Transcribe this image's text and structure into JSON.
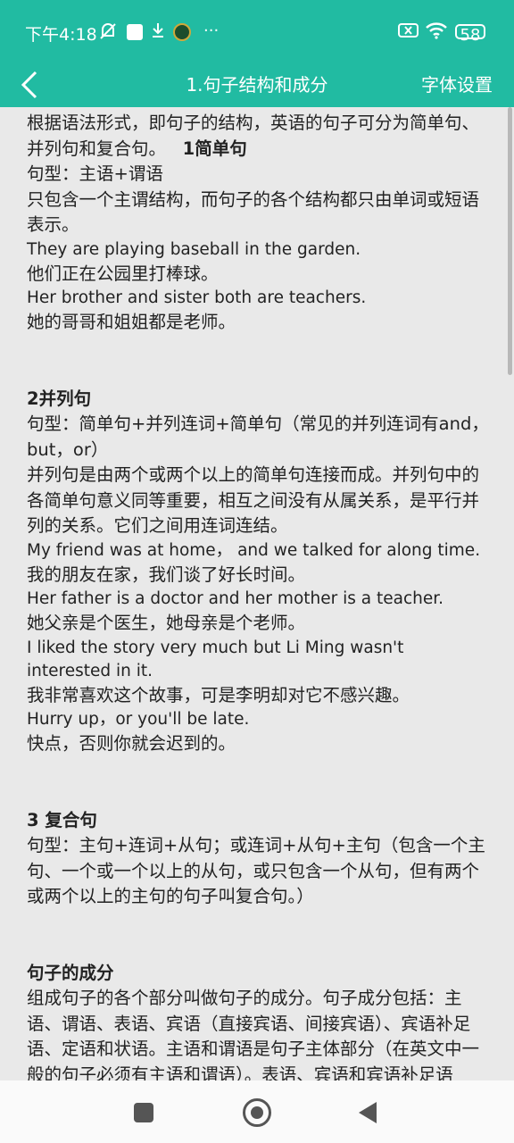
{
  "status_bar": {
    "time": "下午4:18",
    "battery": "58",
    "icons": [
      "mute-icon",
      "white-square-icon",
      "download-icon",
      "app-badge-icon",
      "more-icon",
      "notification-x-icon",
      "wifi-icon",
      "battery-icon"
    ]
  },
  "toolbar": {
    "title": "1.句子结构和成分",
    "font_settings": "字体设置",
    "back_icon": "chevron-left-icon",
    "color": "#21bba2"
  },
  "content": {
    "intro": "根据语法形式，即句子的结构，英语的句子可分为简单句、并列句和复合句。",
    "section1_heading": "1简单句",
    "section1": [
      {
        "text": "句型：主语+谓语",
        "lang": "zh"
      },
      {
        "text": "只包含一个主谓结构，而句子的各个结构都只由单词或短语表示。",
        "lang": "zh"
      },
      {
        "text": "They are playing baseball in the garden.",
        "lang": "en"
      },
      {
        "text": "他们正在公园里打棒球。",
        "lang": "zh"
      },
      {
        "text": "Her brother and sister both are teachers.",
        "lang": "en"
      },
      {
        "text": "她的哥哥和姐姐都是老师。",
        "lang": "zh"
      }
    ],
    "section2_heading": "2并列句",
    "section2": [
      {
        "text": "句型：简单句+并列连词+简单句（常见的并列连词有and，but，or）",
        "lang": "zh"
      },
      {
        "text": "并列句是由两个或两个以上的简单句连接而成。并列句中的各简单句意义同等重要，相互之间没有从属关系，是平行并列的关系。它们之间用连词连结。",
        "lang": "zh"
      },
      {
        "text": "My friend was at home， and we talked for along time.",
        "lang": "en"
      },
      {
        "text": "我的朋友在家，我们谈了好长时间。",
        "lang": "zh"
      },
      {
        "text": "Her father is a doctor and her mother is a teacher.",
        "lang": "en"
      },
      {
        "text": "她父亲是个医生，她母亲是个老师。",
        "lang": "zh"
      },
      {
        "text": "I liked the story very much but Li Ming wasn't interested in it.",
        "lang": "en"
      },
      {
        "text": "我非常喜欢这个故事，可是李明却对它不感兴趣。",
        "lang": "zh"
      },
      {
        "text": "Hurry up，or you'll be late.",
        "lang": "en"
      },
      {
        "text": "快点，否则你就会迟到的。",
        "lang": "zh"
      }
    ],
    "section3_heading": "3 复合句",
    "section3": [
      {
        "text": "句型：主句+连词+从句；或连词+从句+主句（包含一个主句、一个或一个以上的从句，或只包含一个从句，但有两个或两个以上的主句的句子叫复合句。）",
        "lang": "zh"
      }
    ],
    "section4_heading": "句子的成分",
    "section4": [
      {
        "text": "组成句子的各个部分叫做句子的成分。句子成分包括：主语、谓语、表语、宾语（直接宾语、间接宾语）、宾语补足语、定语和状语。主语和谓语是句子主体部分（在英文中一般的句子必须有主语和谓语）。表语、宾语和宾语补足语",
        "lang": "zh"
      }
    ]
  },
  "nav_bar": {
    "icons": [
      "recents-square-icon",
      "home-circle-icon",
      "back-triangle-icon"
    ]
  }
}
